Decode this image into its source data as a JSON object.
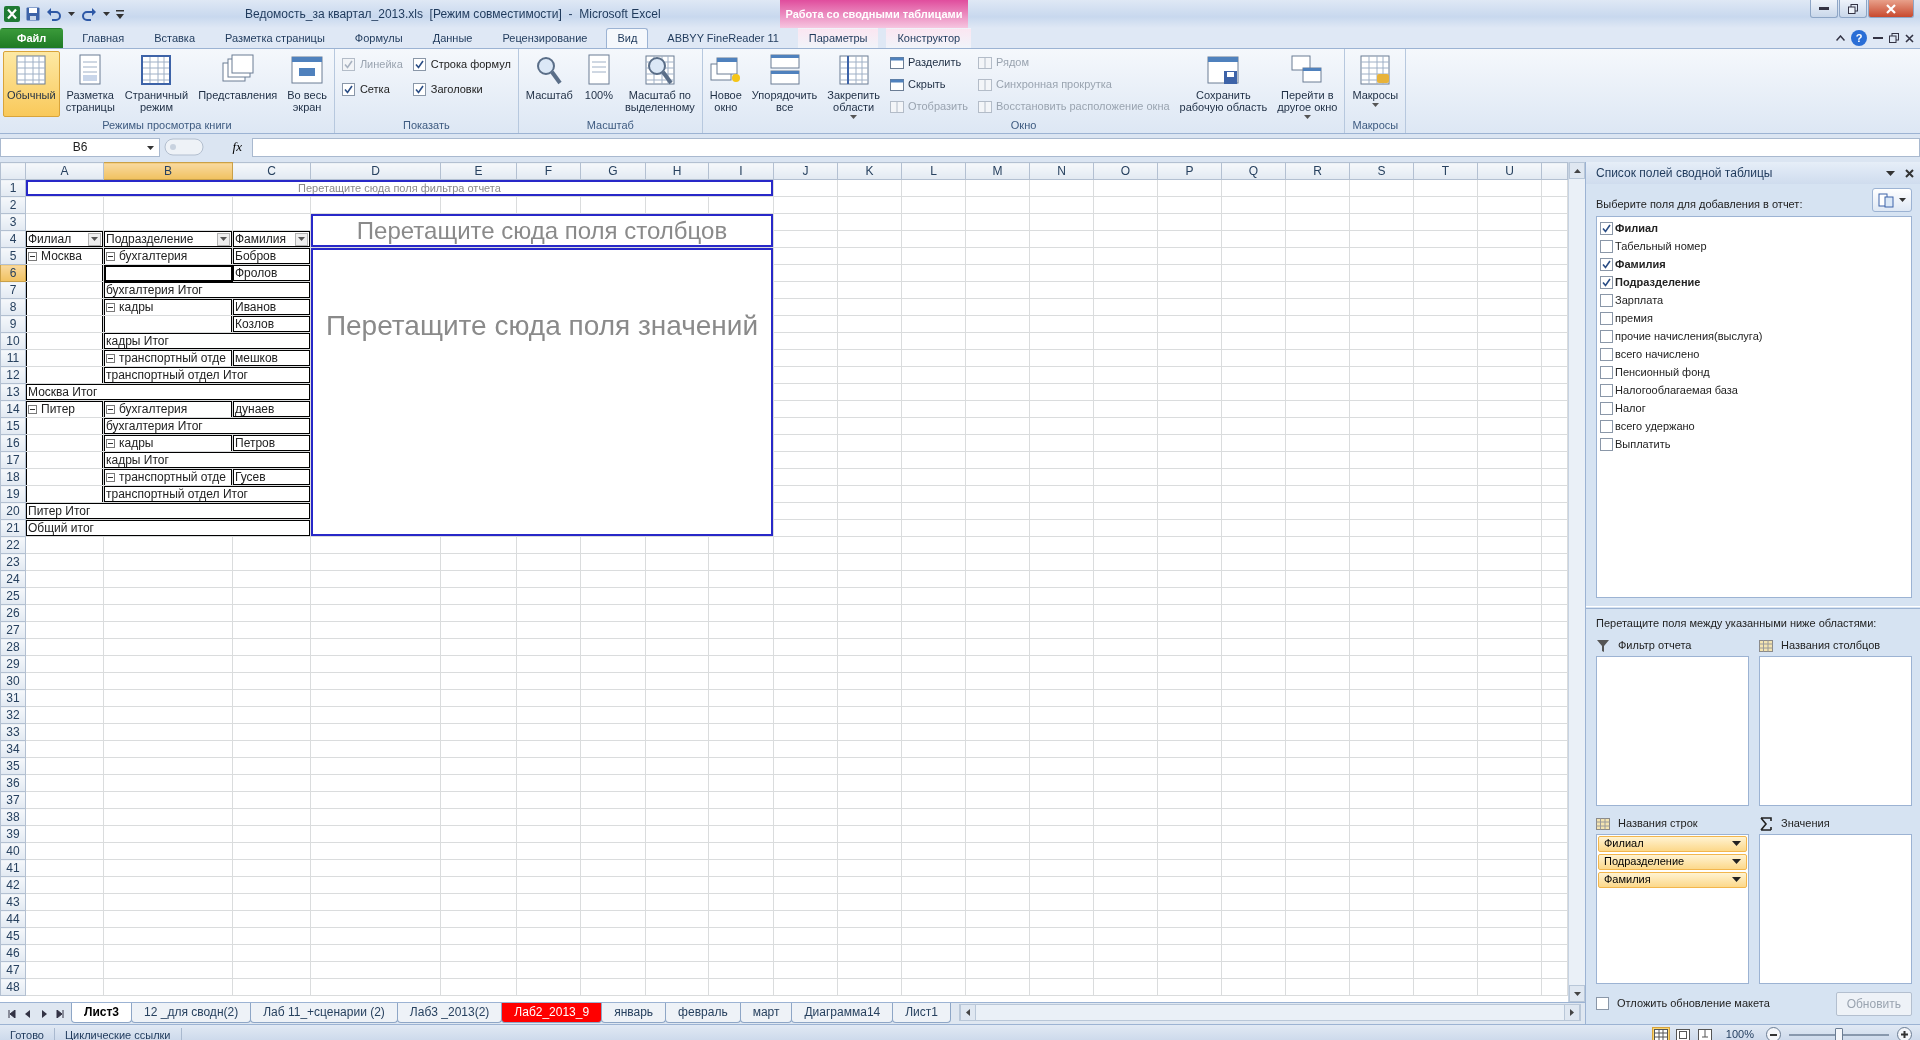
{
  "window": {
    "title": "Ведомость_за квартал_2013.xls  [Режим совместимости]  -  Microsoft Excel",
    "context_group": "Работа со сводными таблицами",
    "help": "?"
  },
  "ribbon": {
    "tabs": [
      {
        "label": "Файл",
        "kind": "file",
        "selected": false
      },
      {
        "label": "Главная",
        "kind": "normal",
        "selected": false
      },
      {
        "label": "Вставка",
        "kind": "normal",
        "selected": false
      },
      {
        "label": "Разметка страницы",
        "kind": "normal",
        "selected": false
      },
      {
        "label": "Формулы",
        "kind": "normal",
        "selected": false
      },
      {
        "label": "Данные",
        "kind": "normal",
        "selected": false
      },
      {
        "label": "Рецензирование",
        "kind": "normal",
        "selected": false
      },
      {
        "label": "Вид",
        "kind": "normal",
        "selected": true
      },
      {
        "label": "ABBYY FineReader 11",
        "kind": "normal",
        "selected": false
      },
      {
        "label": "Параметры",
        "kind": "context",
        "selected": false
      },
      {
        "label": "Конструктор",
        "kind": "context",
        "selected": false
      }
    ],
    "groups": [
      {
        "label": "Режимы просмотра книги",
        "controls": [
          {
            "kind": "large",
            "label": "Обычный",
            "selected": true
          },
          {
            "kind": "large",
            "label": "Разметка\nстраницы",
            "selected": false
          },
          {
            "kind": "large",
            "label": "Страничный\nрежим",
            "selected": false
          },
          {
            "kind": "large",
            "label": "Представления"
          },
          {
            "kind": "large",
            "label": "Во весь\nэкран"
          }
        ]
      },
      {
        "label": "Показать",
        "controls": [
          {
            "kind": "stack",
            "items": [
              {
                "kind": "checkbox",
                "label": "Линейка",
                "checked": true,
                "disabled": true
              },
              {
                "kind": "checkbox",
                "label": "Сетка",
                "checked": true,
                "disabled": false
              }
            ]
          },
          {
            "kind": "stack",
            "items": [
              {
                "kind": "checkbox",
                "label": "Строка формул",
                "checked": true,
                "disabled": false
              },
              {
                "kind": "checkbox",
                "label": "Заголовки",
                "checked": true,
                "disabled": false
              }
            ]
          }
        ]
      },
      {
        "label": "Масштаб",
        "controls": [
          {
            "kind": "large",
            "label": "Масштаб"
          },
          {
            "kind": "large",
            "label": "100%"
          },
          {
            "kind": "large",
            "label": "Масштаб по\nвыделенному"
          }
        ]
      },
      {
        "label": "Окно",
        "controls": [
          {
            "kind": "large",
            "label": "Новое\nокно"
          },
          {
            "kind": "large",
            "label": "Упорядочить\nвсе"
          },
          {
            "kind": "large",
            "label": "Закрепить\nобласти",
            "dropdown": true
          },
          {
            "kind": "stack",
            "items": [
              {
                "kind": "small",
                "label": "Разделить",
                "disabled": false
              },
              {
                "kind": "small",
                "label": "Скрыть",
                "disabled": false
              },
              {
                "kind": "small",
                "label": "Отобразить",
                "disabled": true
              }
            ]
          },
          {
            "kind": "stack",
            "items": [
              {
                "kind": "small",
                "label": "Рядом",
                "disabled": true
              },
              {
                "kind": "small",
                "label": "Синхронная прокрутка",
                "disabled": true
              },
              {
                "kind": "small",
                "label": "Восстановить расположение окна",
                "disabled": true
              }
            ]
          },
          {
            "kind": "large",
            "label": "Сохранить\nрабочую область"
          },
          {
            "kind": "large",
            "label": "Перейти в\nдругое окно",
            "dropdown": true
          }
        ]
      },
      {
        "label": "Макросы",
        "controls": [
          {
            "kind": "large",
            "label": "Макросы",
            "dropdown": true
          }
        ]
      }
    ]
  },
  "formula_bar": {
    "name_box": "B6",
    "function_button": "fx"
  },
  "sheet": {
    "columns": [
      {
        "label": "A",
        "selected": false
      },
      {
        "label": "B",
        "selected": true
      },
      {
        "label": "C",
        "selected": false
      },
      {
        "label": "D",
        "selected": false
      },
      {
        "label": "E",
        "selected": false
      },
      {
        "label": "F",
        "selected": false
      },
      {
        "label": "G",
        "selected": false
      },
      {
        "label": "H",
        "selected": false
      },
      {
        "label": "I",
        "selected": false
      },
      {
        "label": "J",
        "selected": false
      },
      {
        "label": "K",
        "selected": false
      },
      {
        "label": "L",
        "selected": false
      },
      {
        "label": "M",
        "selected": false
      },
      {
        "label": "N",
        "selected": false
      },
      {
        "label": "O",
        "selected": false
      },
      {
        "label": "P",
        "selected": false
      },
      {
        "label": "Q",
        "selected": false
      },
      {
        "label": "R",
        "selected": false
      },
      {
        "label": "S",
        "selected": false
      },
      {
        "label": "T",
        "selected": false
      },
      {
        "label": "U",
        "selected": false
      }
    ],
    "rows": [
      {
        "label": "1",
        "selected": false
      },
      {
        "label": "2",
        "selected": false
      },
      {
        "label": "3",
        "selected": false
      },
      {
        "label": "4",
        "selected": false
      },
      {
        "label": "5",
        "selected": false
      },
      {
        "label": "6",
        "selected": true
      },
      {
        "label": "7",
        "selected": false
      },
      {
        "label": "8",
        "selected": false
      },
      {
        "label": "9",
        "selected": false
      },
      {
        "label": "10",
        "selected": false
      },
      {
        "label": "11",
        "selected": false
      },
      {
        "label": "12",
        "selected": false
      },
      {
        "label": "13",
        "selected": false
      },
      {
        "label": "14",
        "selected": false
      },
      {
        "label": "15",
        "selected": false
      },
      {
        "label": "16",
        "selected": false
      },
      {
        "label": "17",
        "selected": false
      },
      {
        "label": "18",
        "selected": false
      },
      {
        "label": "19",
        "selected": false
      },
      {
        "label": "20",
        "selected": false
      },
      {
        "label": "21",
        "selected": false
      },
      {
        "label": "22",
        "selected": false
      },
      {
        "label": "23",
        "selected": false
      },
      {
        "label": "24",
        "selected": false
      },
      {
        "label": "25",
        "selected": false
      },
      {
        "label": "26",
        "selected": false
      },
      {
        "label": "27",
        "selected": false
      },
      {
        "label": "28",
        "selected": false
      },
      {
        "label": "29",
        "selected": false
      },
      {
        "label": "30",
        "selected": false
      },
      {
        "label": "31",
        "selected": false
      },
      {
        "label": "32",
        "selected": false
      },
      {
        "label": "33",
        "selected": false
      },
      {
        "label": "34",
        "selected": false
      },
      {
        "label": "35",
        "selected": false
      },
      {
        "label": "36",
        "selected": false
      },
      {
        "label": "37",
        "selected": false
      },
      {
        "label": "38",
        "selected": false
      },
      {
        "label": "39",
        "selected": false
      },
      {
        "label": "40",
        "selected": false
      },
      {
        "label": "41",
        "selected": false
      },
      {
        "label": "42",
        "selected": false
      },
      {
        "label": "43",
        "selected": false
      },
      {
        "label": "44",
        "selected": false
      },
      {
        "label": "45",
        "selected": false
      },
      {
        "label": "46",
        "selected": false
      },
      {
        "label": "47",
        "selected": false
      },
      {
        "label": "48",
        "selected": false
      }
    ],
    "pivot": {
      "filter_placeholder": "Перетащите сюда поля фильтра отчета",
      "column_placeholder": "Перетащите сюда поля столбцов",
      "value_placeholder": "Перетащите сюда поля значений",
      "headers": [
        "Филиал",
        "Подразделение",
        "Фамилия"
      ],
      "rows": [
        {
          "kind": "item",
          "branch": {
            "text": "Москва",
            "expanded": true
          },
          "department": {
            "text": "бухгалтерия",
            "expanded": true
          },
          "name": "Бобров"
        },
        {
          "kind": "item",
          "name": "Фролов"
        },
        {
          "kind": "subtotal",
          "text": "бухгалтерия Итог"
        },
        {
          "kind": "item",
          "department": {
            "text": "кадры",
            "expanded": true
          },
          "name": "Иванов"
        },
        {
          "kind": "item",
          "name": "Козлов"
        },
        {
          "kind": "subtotal",
          "text": "кадры Итог"
        },
        {
          "kind": "item",
          "department": {
            "text": "транспортный отде",
            "expanded": true
          },
          "name": "мешков"
        },
        {
          "kind": "subtotal",
          "text": "транспортный отдел Итог"
        },
        {
          "kind": "total",
          "text": "Москва Итог"
        },
        {
          "kind": "item",
          "branch": {
            "text": "Питер",
            "expanded": true
          },
          "department": {
            "text": "бухгалтерия",
            "expanded": true
          },
          "name": "дунаев"
        },
        {
          "kind": "subtotal",
          "text": "бухгалтерия Итог"
        },
        {
          "kind": "item",
          "department": {
            "text": "кадры",
            "expanded": true
          },
          "name": "Петров"
        },
        {
          "kind": "subtotal",
          "text": "кадры Итог"
        },
        {
          "kind": "item",
          "department": {
            "text": "транспортный отде",
            "expanded": true
          },
          "name": "Гусев"
        },
        {
          "kind": "subtotal",
          "text": "транспортный отдел Итог"
        },
        {
          "kind": "total",
          "text": "Питер Итог"
        },
        {
          "kind": "total",
          "text": "Общий итог"
        }
      ]
    }
  },
  "sheet_tabs": [
    {
      "label": "Лист3",
      "selected": true
    },
    {
      "label": "12 _для сводн(2)",
      "selected": false
    },
    {
      "label": "Лаб 11_+сценарии (2)",
      "selected": false
    },
    {
      "label": "Лаб3 _2013(2)",
      "selected": false
    },
    {
      "label": "Лаб2_2013_9",
      "selected": false,
      "color": "#ff0000"
    },
    {
      "label": "январь",
      "selected": false
    },
    {
      "label": "февраль",
      "selected": false
    },
    {
      "label": "март",
      "selected": false
    },
    {
      "label": "Диаграмма14",
      "selected": false
    },
    {
      "label": "Лист1",
      "selected": false
    }
  ],
  "field_pane": {
    "title": "Список полей сводной таблицы",
    "fields_label": "Выберите поля для добавления в отчет:",
    "fields": [
      {
        "label": "Филиал",
        "checked": true
      },
      {
        "label": "Табельный номер",
        "checked": false
      },
      {
        "label": "Фамилия",
        "checked": true
      },
      {
        "label": "Подразделение",
        "checked": true
      },
      {
        "label": "Зарплата",
        "checked": false
      },
      {
        "label": "премия",
        "checked": false
      },
      {
        "label": "прочие начисления(выслуга)",
        "checked": false
      },
      {
        "label": "всего начислено",
        "checked": false
      },
      {
        "label": "Пенсионный фонд",
        "checked": false
      },
      {
        "label": "Налогооблагаемая база",
        "checked": false
      },
      {
        "label": "Налог",
        "checked": false
      },
      {
        "label": "всего удержано",
        "checked": false
      },
      {
        "label": "Выплатить",
        "checked": false
      }
    ],
    "areas_label": "Перетащите поля между указанными ниже областями:",
    "areas": [
      {
        "kind": "filter",
        "label": "Фильтр отчета"
      },
      {
        "kind": "columns",
        "label": "Названия столбцов"
      },
      {
        "kind": "rows",
        "label": "Названия строк",
        "items": [
          "Филиал",
          "Подразделение",
          "Фамилия"
        ]
      },
      {
        "kind": "values",
        "label": "Значения"
      }
    ],
    "defer_update": {
      "label": "Отложить обновление макета",
      "checked": false
    },
    "update_button": {
      "label": "Обновить",
      "disabled": true
    }
  },
  "status_bar": {
    "items": [
      "Готово",
      "Циклические ссылки"
    ],
    "views": [
      {
        "kind": "normal",
        "selected": true
      },
      {
        "kind": "page_layout",
        "selected": false
      },
      {
        "kind": "page_break",
        "selected": false
      }
    ],
    "zoom": "100%",
    "zoom_slider": {
      "level": 0.5
    }
  }
}
